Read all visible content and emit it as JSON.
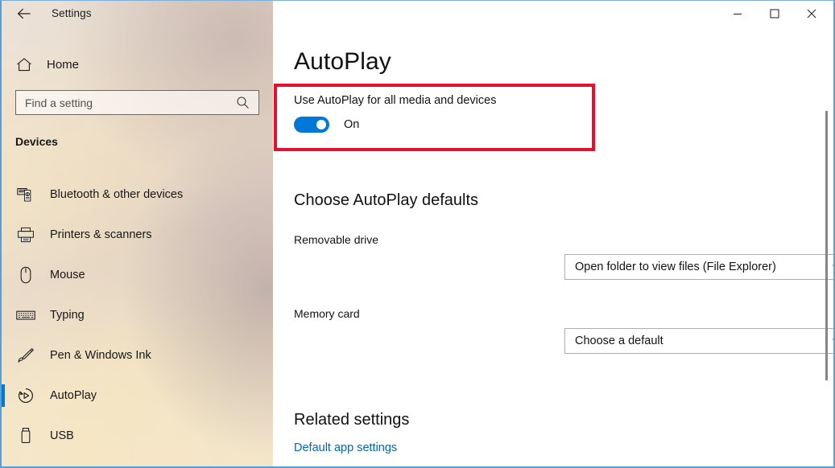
{
  "window": {
    "title": "Settings",
    "back_icon": "back-arrow-icon",
    "controls": {
      "minimize": "minimize-icon",
      "maximize": "maximize-icon",
      "close": "close-icon"
    }
  },
  "sidebar": {
    "home": {
      "label": "Home",
      "icon": "home-icon"
    },
    "search": {
      "placeholder": "Find a setting",
      "value": "",
      "icon": "search-icon"
    },
    "group_header": "Devices",
    "items": [
      {
        "label": "Bluetooth & other devices",
        "icon": "bluetooth-devices-icon",
        "selected": false
      },
      {
        "label": "Printers & scanners",
        "icon": "printer-icon",
        "selected": false
      },
      {
        "label": "Mouse",
        "icon": "mouse-icon",
        "selected": false
      },
      {
        "label": "Typing",
        "icon": "keyboard-icon",
        "selected": false
      },
      {
        "label": "Pen & Windows Ink",
        "icon": "pen-icon",
        "selected": false
      },
      {
        "label": "AutoPlay",
        "icon": "autoplay-icon",
        "selected": true
      },
      {
        "label": "USB",
        "icon": "usb-icon",
        "selected": false
      }
    ]
  },
  "main": {
    "page_title": "AutoPlay",
    "toggle": {
      "label": "Use AutoPlay for all media and devices",
      "state": "On",
      "checked": true,
      "accent_color": "#0078d7"
    },
    "defaults_section": {
      "title": "Choose AutoPlay defaults",
      "fields": [
        {
          "label": "Removable drive",
          "value": "Open folder to view files (File Explorer)"
        },
        {
          "label": "Memory card",
          "value": "Choose a default"
        }
      ],
      "dropdown_icon": "chevron-down-icon"
    },
    "related_section": {
      "title": "Related settings",
      "link": "Default app settings",
      "link_color": "#0067b8"
    }
  },
  "annotation": {
    "highlight_color": "#e8112d"
  }
}
